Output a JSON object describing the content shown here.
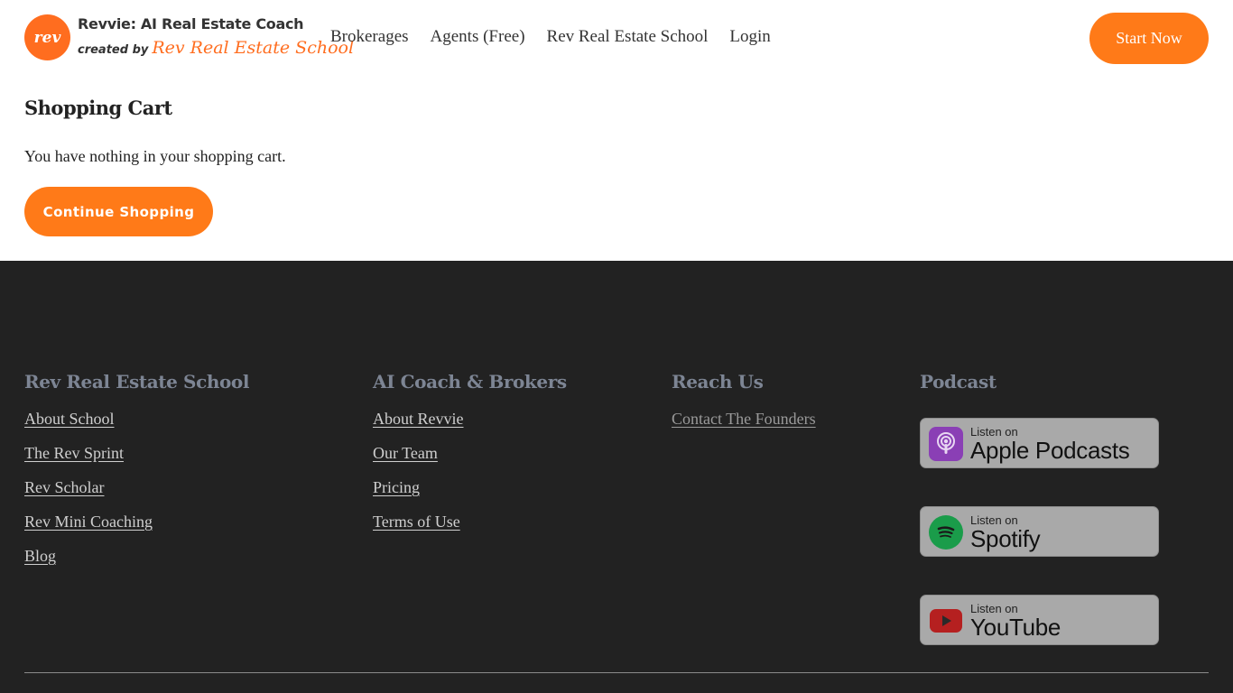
{
  "header": {
    "logo": {
      "mark": "rev",
      "title": "Revvie: AI Real Estate Coach",
      "created_by": "created by",
      "script": "Rev Real Estate School"
    },
    "nav": [
      "Brokerages",
      "Agents (Free)",
      "Rev Real Estate School",
      "Login"
    ],
    "cta": "Start Now"
  },
  "main": {
    "title": "Shopping Cart",
    "message": "You have nothing in your shopping cart.",
    "button": "Continue Shopping"
  },
  "footer": {
    "columns": [
      {
        "heading": "Rev Real Estate School",
        "links": [
          "About School",
          "The Rev Sprint",
          "Rev Scholar",
          "Rev Mini Coaching",
          "Blog"
        ]
      },
      {
        "heading": "AI Coach & Brokers",
        "links": [
          "About Revvie",
          "Our Team",
          "Pricing",
          "Terms of Use"
        ]
      },
      {
        "heading": "Reach Us",
        "links": [
          "Contact The Founders"
        ]
      }
    ],
    "podcast": {
      "heading": "Podcast",
      "badges": [
        {
          "small": "Listen on",
          "big": "Apple Podcasts",
          "icon": "apple-podcasts-icon"
        },
        {
          "small": "Listen on",
          "big": "Spotify",
          "icon": "spotify-icon"
        },
        {
          "small": "Listen on",
          "big": "YouTube",
          "icon": "youtube-icon"
        }
      ]
    }
  },
  "colors": {
    "accent": "#ff7a18",
    "footer_bg": "#222222",
    "footer_heading": "#7d8594"
  }
}
